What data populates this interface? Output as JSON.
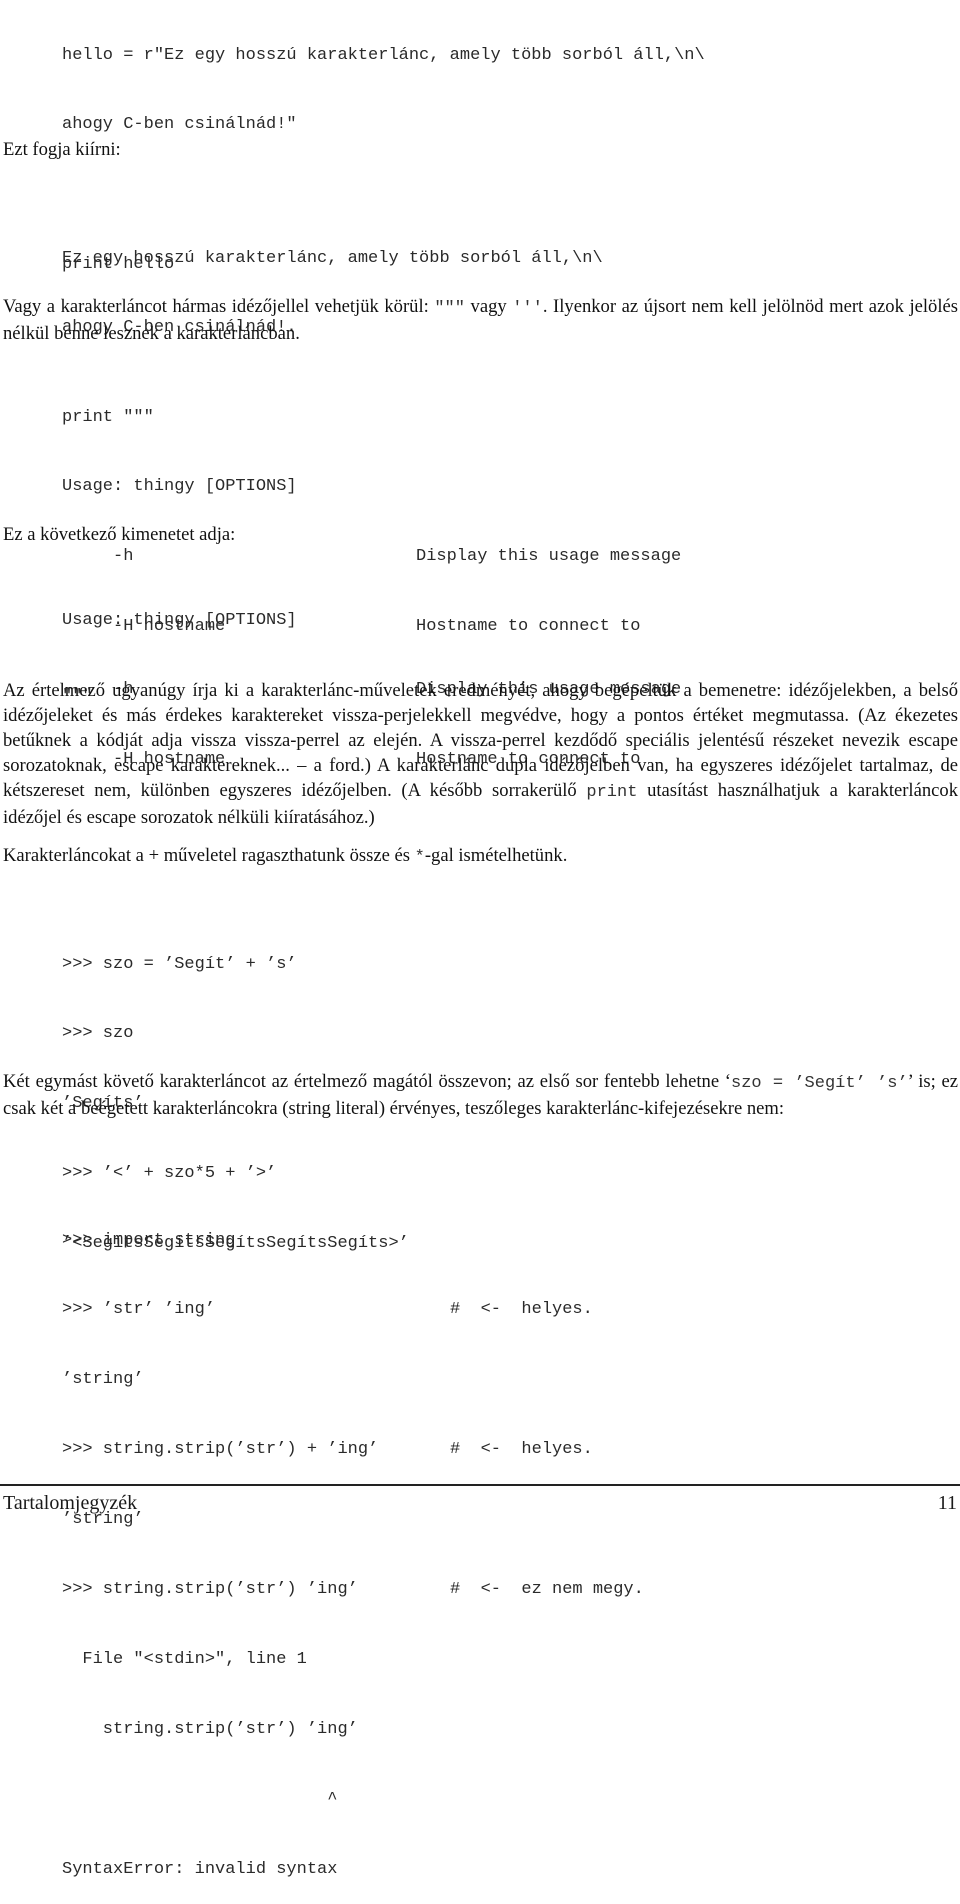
{
  "code_block_1": {
    "lines": [
      "hello = r\"Ez egy hosszú karakterlánc, amely több sorból áll,\\n\\",
      "ahogy C-ben csinálnád!\"",
      "",
      "print hello"
    ]
  },
  "para_1": "Ezt fogja kiírni:",
  "output_block_1": {
    "lines": [
      "Ez egy hosszú karakterlánc, amely több sorból áll,\\n\\",
      "ahogy C-ben csinálnád!."
    ]
  },
  "para_2": {
    "before": "Vagy a karakterláncot hármas idézőjellel vehetjük körül: ",
    "code1": "\"\"\"",
    "middle": " vagy ",
    "code2": "'''",
    "after": ". Ilyenkor az újsort nem kell jelölnöd mert azok jelölés nélkül benne lesznek a karakterláncban."
  },
  "code_block_2": {
    "line1": "print \"\"\"",
    "line2": "Usage: thingy [OPTIONS]",
    "options": [
      {
        "flag": "     -h",
        "desc": "Display this usage message"
      },
      {
        "flag": "     -H hostname",
        "desc": "Hostname to connect to"
      }
    ],
    "line_end": "\"\"\""
  },
  "para_3": "Ez a következő kimenetet adja:",
  "output_block_2": {
    "line1": "Usage: thingy [OPTIONS]",
    "options": [
      {
        "flag": "     -h",
        "desc": "Display this usage message"
      },
      {
        "flag": "     -H hostname",
        "desc": "Hostname to connect to"
      }
    ]
  },
  "para_4": {
    "before": "Az értelmező ugyanúgy írja ki a karakterlánc-műveletek eredményét, ahogy begépeltük a bemenetre: idézőjelekben, a belső idézőjeleket és más érdekes karaktereket vissza-perjelekkell megvédve, hogy a pontos értéket megmutassa. (Az ékezetes betűknek a kódját adja vissza vissza-perrel az elején. A vissza-perrel kezdődő speciális jelentésű részeket nevezik escape sorozatoknak, escape karaktereknek... – a ford.) A karakterlánc dupla idézőjelben van, ha egyszeres idézőjelet tartalmaz, de kétszereset nem, különben egyszeres idézőjelben. (A később sorrakerülő ",
    "code": "print",
    "after": " utasítást használhatjuk a karakterláncok idézőjel és escape sorozatok nélküli kiíratásához.)"
  },
  "para_5": {
    "before": "Karakterláncokat a + műveletel ragaszthatunk össze és ",
    "code": "*",
    "after": "-gal ismételhetünk."
  },
  "code_block_3": {
    "lines": [
      ">>> szo = ’Segít’ + ’s’",
      ">>> szo",
      "’Segíts’",
      ">>> ’<’ + szo*5 + ’>’",
      "’<SegítsSegítsSegítsSegítsSegíts>’"
    ]
  },
  "para_6": {
    "before": "Két egymást követő karakterláncot az értelmező magától összevon; az első sor fentebb lehetne ‘",
    "code": "szo = ’Segít’ ’s’",
    "after": "’ is; ez csak két a beégetett karakterláncokra (string literal) érvényes, teszőleges karakterlánc-kifejezésekre nem:"
  },
  "code_block_4": {
    "lines": [
      {
        "code": ">>> import string",
        "comment": ""
      },
      {
        "code": ">>> ’str’ ’ing’",
        "comment": "#  <-  helyes."
      },
      {
        "code": "’string’",
        "comment": ""
      },
      {
        "code": ">>> string.strip(’str’) + ’ing’",
        "comment": "#  <-  helyes."
      },
      {
        "code": "’string’",
        "comment": ""
      },
      {
        "code": ">>> string.strip(’str’) ’ing’",
        "comment": "#  <-  ez nem megy."
      },
      {
        "code": "  File \"<stdin>\", line 1",
        "comment": ""
      },
      {
        "code": "    string.strip(’str’) ’ing’",
        "comment": ""
      },
      {
        "code": "                          ^",
        "comment": ""
      },
      {
        "code": "SyntaxError: invalid syntax",
        "comment": ""
      }
    ]
  },
  "footer": {
    "title": "Tartalomjegyzék",
    "page_number": "11"
  }
}
